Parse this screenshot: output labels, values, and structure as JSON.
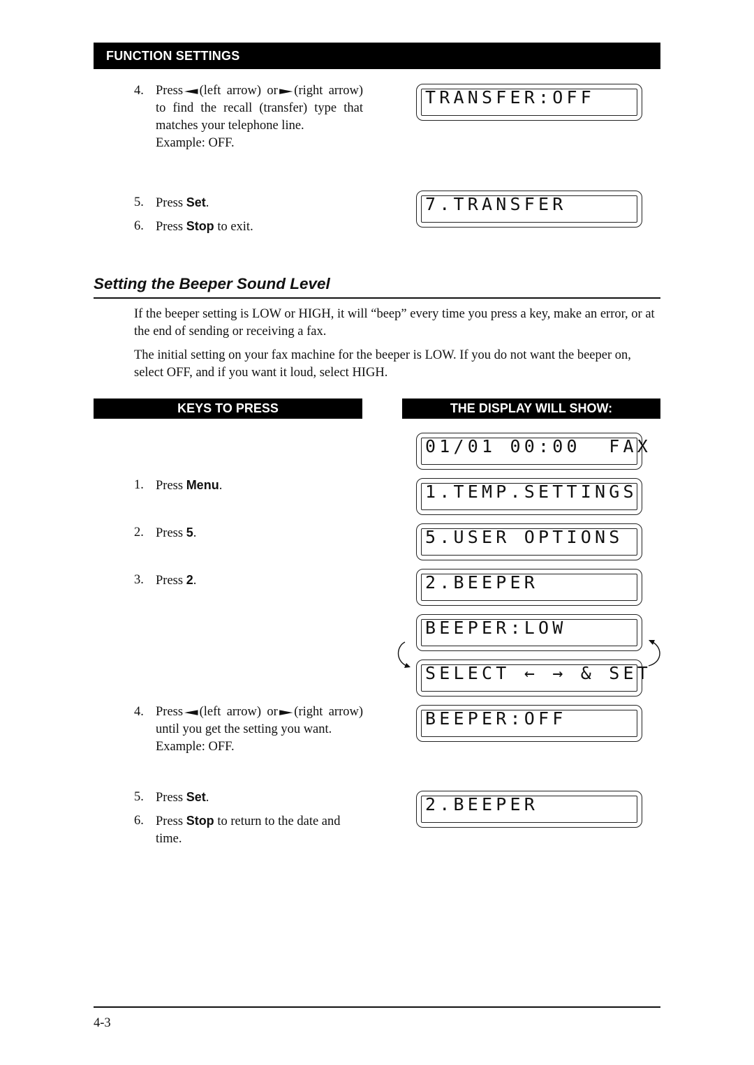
{
  "header": {
    "section_title": "FUNCTION SETTINGS"
  },
  "transfer_steps": {
    "step4": {
      "num": "4.",
      "press": "Press",
      "left_label": "(left arrow) or",
      "right_label": "(right arrow) to find the recall (transfer) type that matches your telephone line.",
      "example": "Example: OFF."
    },
    "step5": {
      "num": "5.",
      "press": "Press",
      "key": "Set",
      "tail": "."
    },
    "step6": {
      "num": "6.",
      "press": "Press",
      "key": "Stop",
      "tail": " to exit."
    }
  },
  "transfer_displays": [
    "TRANSFER:OFF",
    "7.TRANSFER"
  ],
  "section": {
    "heading": "Setting the Beeper Sound Level",
    "para1": "If the beeper setting is LOW or HIGH, it will “beep” every time you press a key, make an error, or at the end of sending or receiving a fax.",
    "para2": "The initial setting on your fax machine for the beeper is LOW. If you do not want the beeper on, select OFF, and if you want it loud, select HIGH."
  },
  "columns": {
    "keys_header": "KEYS TO PRESS",
    "display_header": "THE DISPLAY WILL SHOW:"
  },
  "beeper_steps": {
    "step1": {
      "num": "1.",
      "press": "Press",
      "key": "Menu",
      "tail": "."
    },
    "step2": {
      "num": "2.",
      "press": "Press",
      "key": "5",
      "tail": "."
    },
    "step3": {
      "num": "3.",
      "press": "Press",
      "key": "2",
      "tail": "."
    },
    "step4": {
      "num": "4.",
      "press": "Press",
      "left_label": "(left arrow) or",
      "right_label": "(right arrow) until you get the setting you want.",
      "example": "Example: OFF."
    },
    "step5": {
      "num": "5.",
      "press": "Press",
      "key": "Set",
      "tail": "."
    },
    "step6": {
      "num": "6.",
      "press": "Press",
      "key": "Stop",
      "tail": " to return to the date and time."
    }
  },
  "beeper_displays": [
    "01/01 00:00  FAX",
    "1.TEMP.SETTINGS",
    "5.USER OPTIONS",
    "2.BEEPER",
    "BEEPER:LOW",
    "SELECT ← → & SET",
    "BEEPER:OFF",
    "2.BEEPER"
  ],
  "icons": {
    "left_arrow_key": "◄",
    "right_arrow_key": "►"
  },
  "footer": {
    "page_number": "4-3"
  }
}
